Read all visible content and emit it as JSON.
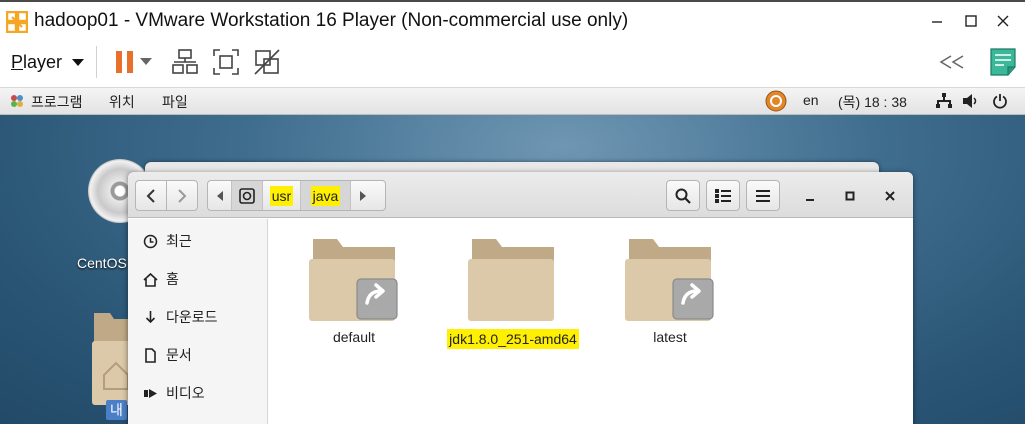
{
  "vmware": {
    "window_title": "hadoop01 - VMware Workstation 16 Player (Non-commercial use only)",
    "player_menu_label": "Player",
    "player_menu_accel": "P",
    "player_menu_rest": "layer"
  },
  "gnome_panel": {
    "menu_programs": "프로그램",
    "menu_places": "위치",
    "menu_files": "파일",
    "input_language": "en",
    "clock": "(목) 18 : 38"
  },
  "desktop": {
    "disc_label": "CentOS",
    "home_label": "내"
  },
  "nautilus": {
    "path_segments": [
      "usr",
      "java"
    ],
    "sidebar": [
      {
        "label": "최근",
        "icon": "clock-icon"
      },
      {
        "label": "홈",
        "icon": "home-icon"
      },
      {
        "label": "다운로드",
        "icon": "download-icon"
      },
      {
        "label": "문서",
        "icon": "document-icon"
      },
      {
        "label": "비디오",
        "icon": "video-icon"
      }
    ],
    "files": [
      {
        "name": "default",
        "symlink": true,
        "highlighted": false
      },
      {
        "name": "jdk1.8.0_251-amd64",
        "symlink": false,
        "highlighted": true
      },
      {
        "name": "latest",
        "symlink": true,
        "highlighted": false
      }
    ]
  },
  "colors": {
    "highlight": "#ffef00",
    "pause_orange": "#e8702a",
    "folder": "#d9c6a6",
    "folder_tab": "#bfa986"
  }
}
